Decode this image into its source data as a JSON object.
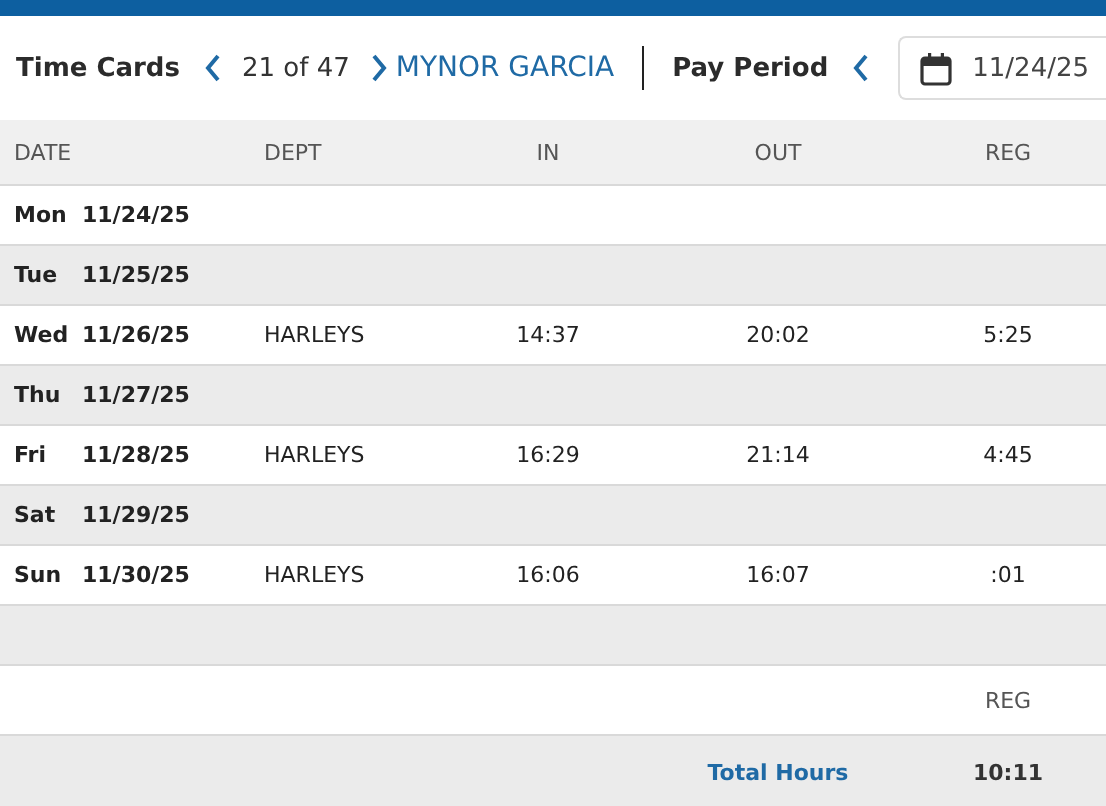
{
  "toolbar": {
    "title": "Time Cards",
    "position": "21 of 47",
    "employee": "MYNOR GARCIA",
    "period_label": "Pay Period",
    "period_start": "11/24/25"
  },
  "table": {
    "columns": [
      "DATE",
      "DEPT",
      "IN",
      "OUT",
      "REG"
    ],
    "rows": [
      {
        "day": "Mon",
        "date": "11/24/25"
      },
      {
        "day": "Tue",
        "date": "11/25/25"
      },
      {
        "day": "Wed",
        "date": "11/26/25",
        "dept": "HARLEYS",
        "in": "14:37",
        "out": "20:02",
        "reg": "5:25"
      },
      {
        "day": "Thu",
        "date": "11/27/25"
      },
      {
        "day": "Fri",
        "date": "11/28/25",
        "dept": "HARLEYS",
        "in": "16:29",
        "out": "21:14",
        "reg": "4:45"
      },
      {
        "day": "Sat",
        "date": "11/29/25"
      },
      {
        "day": "Sun",
        "date": "11/30/25",
        "dept": "HARLEYS",
        "in": "16:06",
        "out": "16:07",
        "reg": ":01"
      }
    ]
  },
  "summary": {
    "column": "REG",
    "label": "Total Hours",
    "total": "10:11"
  }
}
